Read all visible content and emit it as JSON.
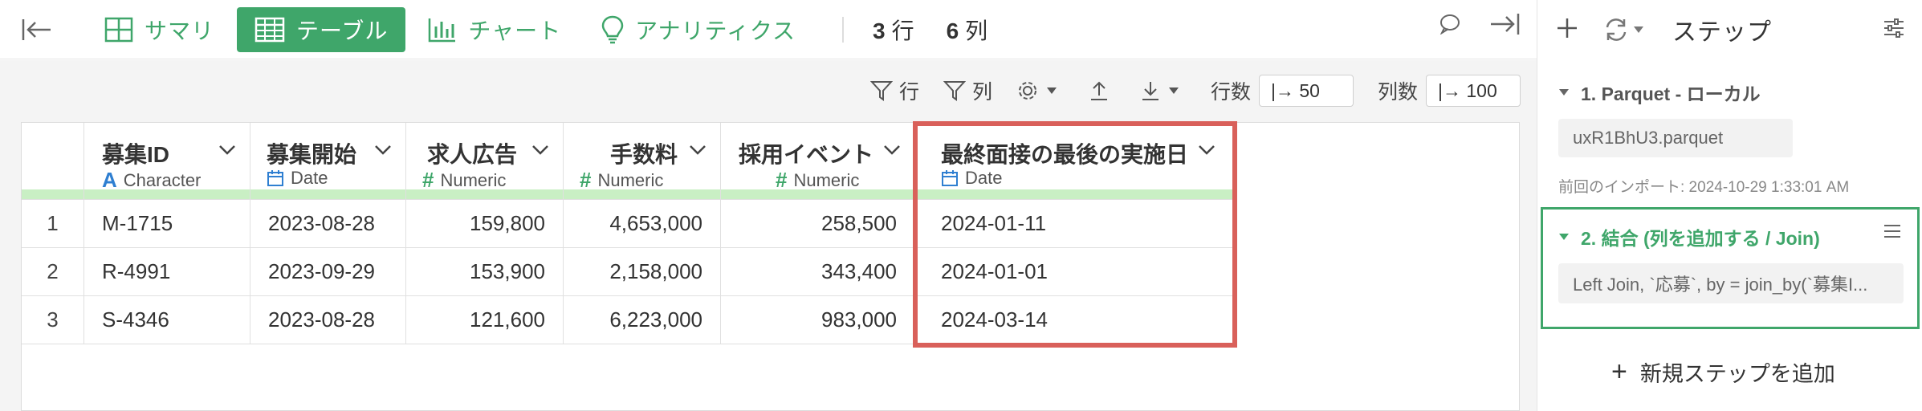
{
  "toolbar": {
    "tabs": [
      {
        "label": "サマリ",
        "icon": "summary-grid-icon",
        "active": false
      },
      {
        "label": "テーブル",
        "icon": "table-icon",
        "active": true
      },
      {
        "label": "チャート",
        "icon": "bar-chart-icon",
        "active": false
      },
      {
        "label": "アナリティクス",
        "icon": "lightbulb-icon",
        "active": false
      }
    ],
    "rows_count": "3",
    "rows_unit": "行",
    "cols_count": "6",
    "cols_unit": "列"
  },
  "subbar": {
    "row_filter": "行",
    "col_filter": "列",
    "rows_label": "行数",
    "rows_value": "|→ 50",
    "cols_label": "列数",
    "cols_value": "|→ 100"
  },
  "table": {
    "columns": [
      {
        "name": "募集ID",
        "type": "Character",
        "type_icon": "A"
      },
      {
        "name": "募集開始",
        "type": "Date",
        "type_icon": "calendar"
      },
      {
        "name": "求人広告",
        "type": "Numeric",
        "type_icon": "#"
      },
      {
        "name": "手数料",
        "type": "Numeric",
        "type_icon": "#"
      },
      {
        "name": "採用イベント",
        "type": "Numeric",
        "type_icon": "#"
      },
      {
        "name": "最終面接の最後の実施日",
        "type": "Date",
        "type_icon": "calendar"
      }
    ],
    "rows": [
      {
        "n": "1",
        "cells": [
          "M-1715",
          "2023-08-28",
          "159,800",
          "4,653,000",
          "258,500",
          "2024-01-11"
        ]
      },
      {
        "n": "2",
        "cells": [
          "R-4991",
          "2023-09-29",
          "153,900",
          "2,158,000",
          "343,400",
          "2024-01-01"
        ]
      },
      {
        "n": "3",
        "cells": [
          "S-4346",
          "2023-08-28",
          "121,600",
          "6,223,000",
          "983,000",
          "2024-03-14"
        ]
      }
    ]
  },
  "panel": {
    "title": "ステップ",
    "step1": {
      "title": "1. Parquet - ローカル",
      "file": "uxR1BhU3.parquet",
      "meta": "前回のインポート: 2024-10-29 1:33:01 AM"
    },
    "step2": {
      "title": "2. 結合 (列を追加する / Join)",
      "detail": "Left Join, `応募`, by = join_by(`募集I..."
    },
    "add_step": "新規ステップを追加"
  },
  "colors": {
    "accent": "#3fa66a",
    "highlight": "#d9605a",
    "header_bar": "#c9efc4"
  }
}
